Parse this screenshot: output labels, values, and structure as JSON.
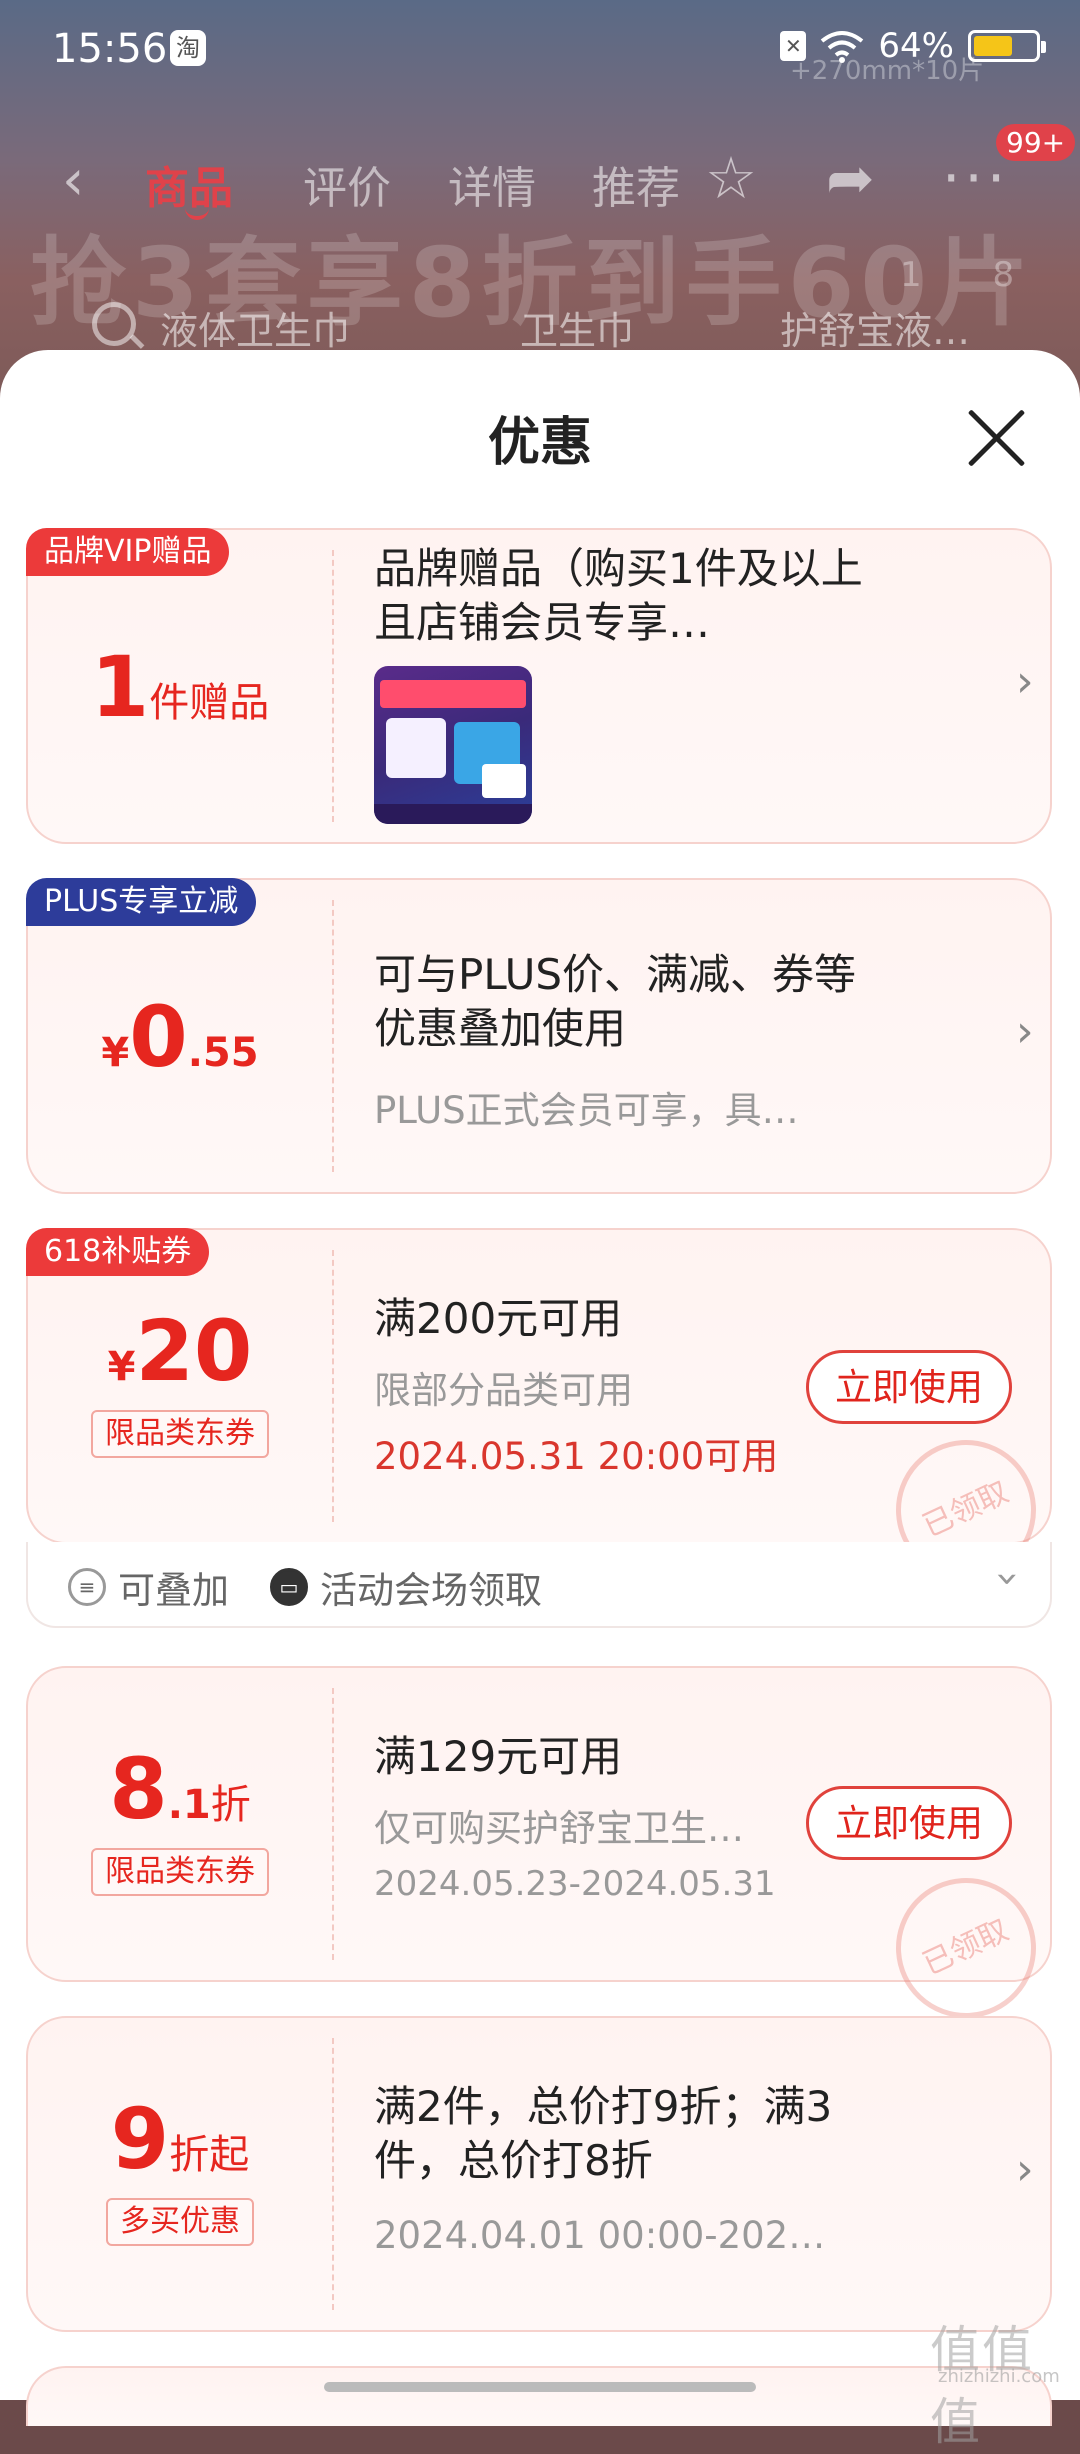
{
  "status_bar": {
    "time": "15:56",
    "app_badge": "淘",
    "battery": "64%",
    "battery_level": 0.64
  },
  "background_page": {
    "banner_text": "抢3套享8折到手60片",
    "banner_sub": "+270mm*10片",
    "banner_corner": "1 8",
    "tabs": [
      "商品",
      "评价",
      "详情",
      "推荐"
    ],
    "active_tab": "商品",
    "badge": "99+",
    "search_tags": [
      "液体卫生巾",
      "卫生巾",
      "护舒宝液…"
    ]
  },
  "sheet": {
    "title": "优惠",
    "cards": [
      {
        "tag": "品牌VIP赠品",
        "big": "1",
        "unit": "件赠品",
        "title": "品牌赠品（购买1件及以上且店铺会员专享…"
      },
      {
        "tag": "PLUS专享立减",
        "currency": "¥",
        "big": "0",
        "decimal": ".55",
        "title": "可与PLUS价、满减、券等优惠叠加使用",
        "sub": "PLUS正式会员可享，具…"
      },
      {
        "tag": "618补贴券",
        "currency": "¥",
        "big": "20",
        "type_tag": "限品类东券",
        "title": "满200元可用",
        "sub": "限部分品类可用",
        "date": "2024.05.31 20:00可用",
        "button": "立即使用",
        "stamp": "已领取",
        "stack_label": "可叠加",
        "source_label": "活动会场领取"
      },
      {
        "big": "8",
        "decimal": ".1",
        "unit": "折",
        "type_tag": "限品类东券",
        "title": "满129元可用",
        "sub": "仅可购买护舒宝卫生…",
        "date": "2024.05.23-2024.05.31",
        "button": "立即使用",
        "stamp": "已领取"
      },
      {
        "big": "9",
        "unit": "折起",
        "type_tag": "多买优惠",
        "title": "满2件，总价打9折；满3件，总价打8折",
        "date": "2024.04.01 00:00-202…"
      }
    ]
  },
  "watermark": {
    "text": "值值值",
    "sub": "zhizhizhi.com"
  },
  "colors": {
    "accent": "#e6261f",
    "plus_blue": "#2d3c9a",
    "tag_red": "#ec3a3a"
  }
}
